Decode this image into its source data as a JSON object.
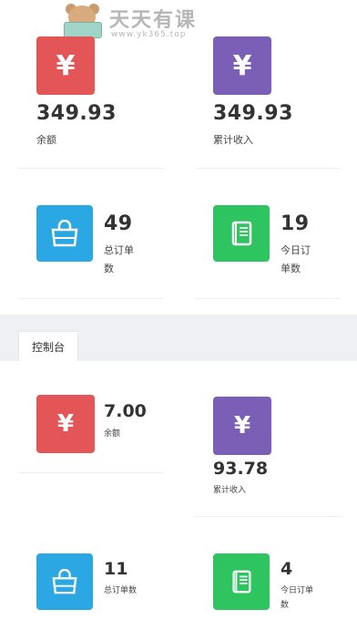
{
  "watermark": {
    "title": "天天有课",
    "url": "www.yk365.top"
  },
  "top_section": {
    "cards": [
      {
        "value": "349.93",
        "label": "余额",
        "icon": "yen-icon"
      },
      {
        "value": "349.93",
        "label": "累计收入",
        "icon": "yen-icon"
      },
      {
        "value": "49",
        "label_line1": "总订单",
        "label_line2": "数",
        "icon": "shopping-bag-icon"
      },
      {
        "value": "19",
        "label_line1": "今日订",
        "label_line2": "单数",
        "icon": "book-icon"
      }
    ]
  },
  "dashboard": {
    "tab_label": "控制台",
    "cards": [
      {
        "value": "7.00",
        "label": "余额",
        "icon": "yen-icon"
      },
      {
        "value": "93.78",
        "label": "累计收入",
        "icon": "yen-icon"
      },
      {
        "value": "11",
        "label": "总订单数",
        "icon": "shopping-bag-icon"
      },
      {
        "value": "4",
        "label_line1": "今日订单",
        "label_line2": "数",
        "icon": "book-icon"
      }
    ]
  },
  "icons": {
    "yen_glyph": "¥"
  },
  "colors": {
    "red": "#e45557",
    "purple": "#7b5fb7",
    "blue": "#2ba8e3",
    "green": "#2ec45f"
  }
}
